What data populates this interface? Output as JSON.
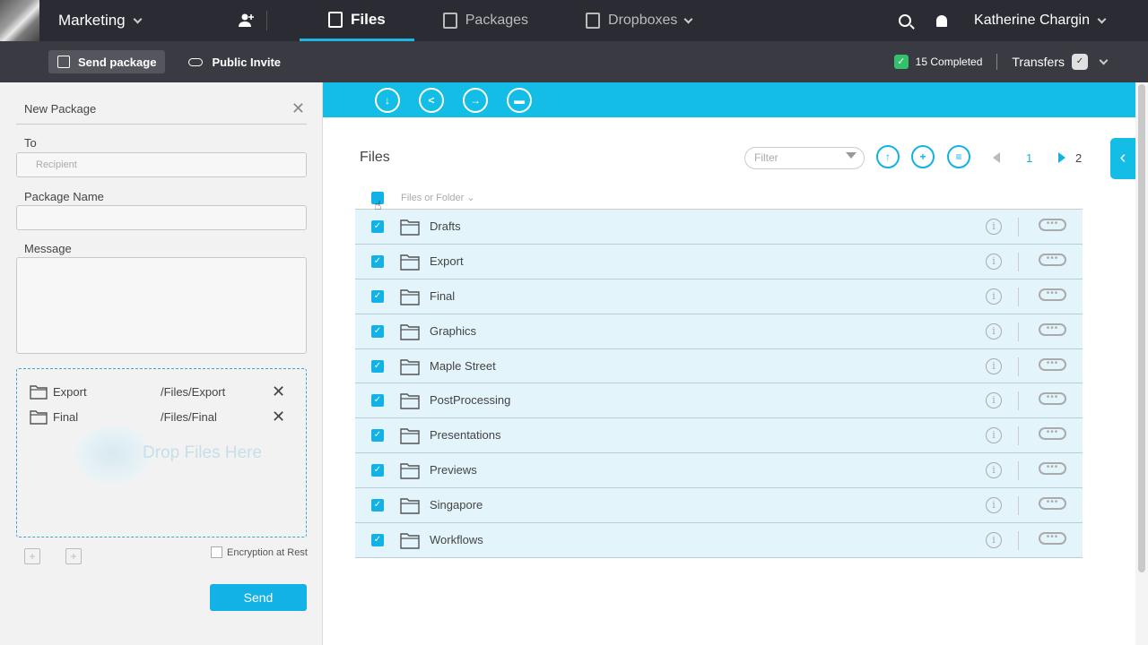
{
  "topbar": {
    "workspace": "Marketing",
    "nav": [
      {
        "label": "Files",
        "active": true
      },
      {
        "label": "Packages",
        "active": false
      },
      {
        "label": "Dropboxes",
        "active": false
      }
    ],
    "user_name": "Katherine Chargin"
  },
  "subbar": {
    "send_package": "Send package",
    "public_invite": "Public Invite",
    "completed": "15 Completed",
    "transfers": "Transfers"
  },
  "new_package": {
    "title": "New Package",
    "to_label": "To",
    "recipient_placeholder": "Recipient",
    "package_name_label": "Package Name",
    "message_label": "Message",
    "attachments": [
      {
        "name": "Export",
        "path": "/Files/Export"
      },
      {
        "name": "Final",
        "path": "/Files/Final"
      }
    ],
    "drop_text": "Drop Files Here",
    "encryption_label": "Encryption at Rest",
    "send_label": "Send"
  },
  "files": {
    "title": "Files",
    "filter_placeholder": "Filter",
    "column_header": "Files or Folder",
    "pages": [
      "1",
      "2"
    ],
    "rows": [
      {
        "name": "Drafts"
      },
      {
        "name": "Export"
      },
      {
        "name": "Final"
      },
      {
        "name": "Graphics"
      },
      {
        "name": "Maple Street"
      },
      {
        "name": "PostProcessing"
      },
      {
        "name": "Presentations"
      },
      {
        "name": "Previews"
      },
      {
        "name": "Singapore"
      },
      {
        "name": "Workflows"
      }
    ]
  },
  "colors": {
    "accent": "#13bde6",
    "topbar_bg": "#2b2b33",
    "subbar_bg": "#3a3a42",
    "row_bg": "#e3f4fb",
    "success": "#33c16b"
  }
}
